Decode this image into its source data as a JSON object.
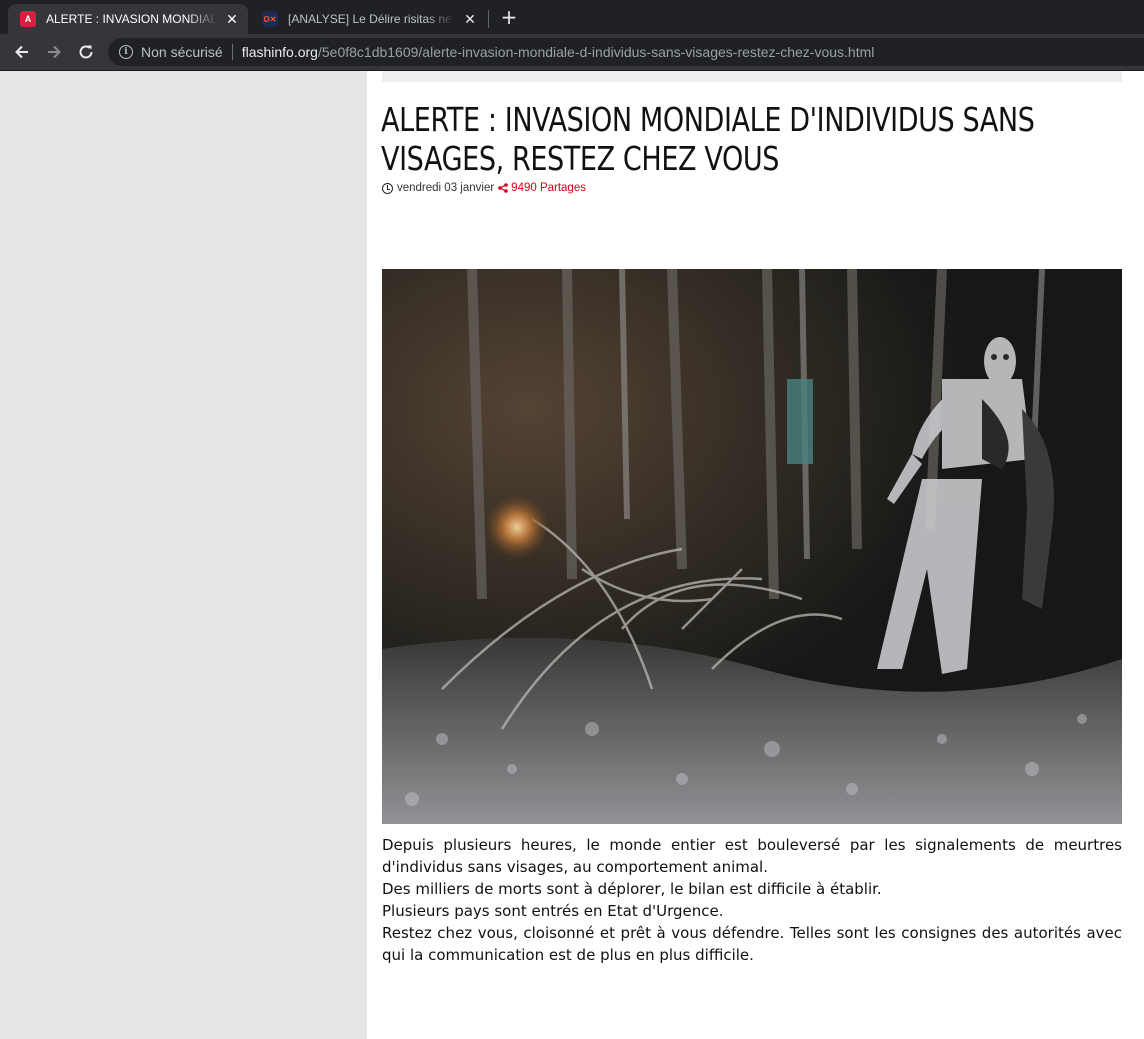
{
  "browser": {
    "tabs": [
      {
        "title": "ALERTE : INVASION MONDIALE D'INDIVIDUS SANS VISAGES",
        "active": true,
        "favicon": "red-a-logo-icon"
      },
      {
        "title": "[ANALYSE] Le Délire risitas ne se",
        "active": false,
        "favicon": "ox-logo-icon"
      }
    ],
    "new_tab_label": "+",
    "security_label": "Non sécurisé",
    "url_host": "flashinfo.org",
    "url_path": "/5e0f8c1db1609/alerte-invasion-mondiale-d-individus-sans-visages-restez-chez-vous.html"
  },
  "article": {
    "title": "ALERTE : INVASION MONDIALE D'INDIVIDUS SANS VISAGES, RESTEZ CHEZ VOUS",
    "date": "vendredi 03 janvier",
    "shares": "9490 Partages",
    "paragraphs": [
      "Depuis plusieurs heures, le monde entier est bouleversé par les signalements de meurtres d'individus sans visages, au comportement animal.",
      "Des milliers de morts sont à déplorer, le bilan est difficile à établir.",
      "Plusieurs pays sont entrés en Etat d'Urgence.",
      "Restez chez vous, cloisonné et prêt à vous défendre. Telles sont les consignes des autorités avec qui la communication est de plus en plus difficile."
    ]
  },
  "colors": {
    "chrome_dark": "#202124",
    "chrome_toolbar": "#35363a",
    "share_red": "#d0021b",
    "page_bg": "#e5e5e5"
  }
}
